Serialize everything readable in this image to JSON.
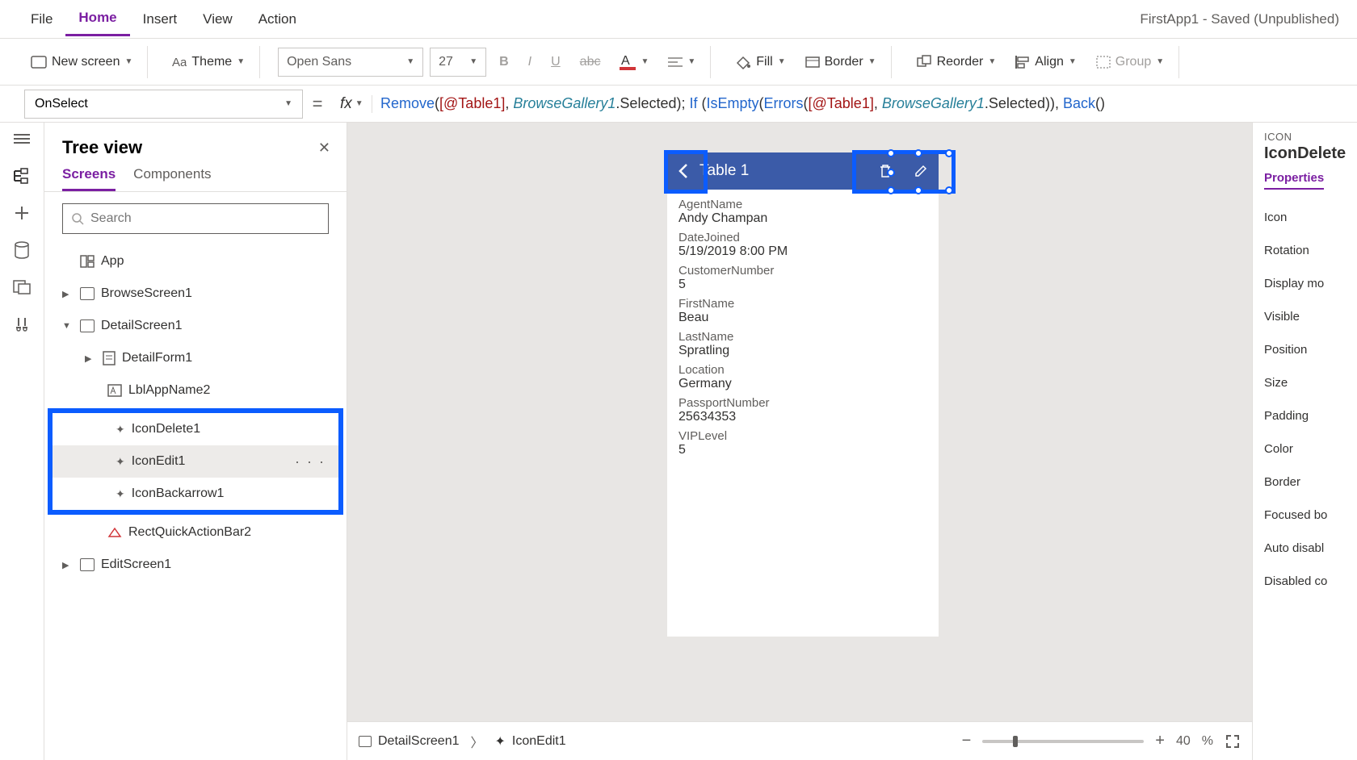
{
  "menu": {
    "file": "File",
    "home": "Home",
    "insert": "Insert",
    "view": "View",
    "action": "Action"
  },
  "app_title": "FirstApp1 - Saved (Unpublished)",
  "ribbon": {
    "new_screen": "New screen",
    "theme": "Theme",
    "font": "Open Sans",
    "size": "27",
    "fill": "Fill",
    "border": "Border",
    "reorder": "Reorder",
    "align": "Align",
    "group": "Group"
  },
  "formula": {
    "property": "OnSelect",
    "tokens": {
      "remove": "Remove",
      "t1": "[@Table1]",
      "bg": "BrowseGallery1",
      "sel": ".Selected",
      "if": "If",
      "ise": "IsEmpty",
      "err": "Errors",
      "back": "Back"
    }
  },
  "tree": {
    "title": "Tree view",
    "tab_screens": "Screens",
    "tab_components": "Components",
    "search_placeholder": "Search",
    "app": "App",
    "browse": "BrowseScreen1",
    "detail": "DetailScreen1",
    "detailform": "DetailForm1",
    "lblapp": "LblAppName2",
    "icon_delete": "IconDelete1",
    "icon_edit": "IconEdit1",
    "icon_back": "IconBackarrow1",
    "rect": "RectQuickActionBar2",
    "edit": "EditScreen1"
  },
  "phone": {
    "title": "Table 1",
    "fields": [
      {
        "label": "AgentName",
        "value": "Andy Champan"
      },
      {
        "label": "DateJoined",
        "value": "5/19/2019 8:00 PM"
      },
      {
        "label": "CustomerNumber",
        "value": "5"
      },
      {
        "label": "FirstName",
        "value": "Beau"
      },
      {
        "label": "LastName",
        "value": "Spratling"
      },
      {
        "label": "Location",
        "value": "Germany"
      },
      {
        "label": "PassportNumber",
        "value": "25634353"
      },
      {
        "label": "VIPLevel",
        "value": "5"
      }
    ]
  },
  "bottom": {
    "crumb1": "DetailScreen1",
    "crumb2": "IconEdit1",
    "zoom": "40",
    "zoom_pct": "%"
  },
  "props": {
    "type": "ICON",
    "name": "IconDelete",
    "tab": "Properties",
    "rows": [
      "Icon",
      "Rotation",
      "Display mo",
      "Visible",
      "Position",
      "Size",
      "Padding",
      "Color",
      "Border",
      "Focused bo",
      "Auto disabl",
      "Disabled co"
    ]
  }
}
